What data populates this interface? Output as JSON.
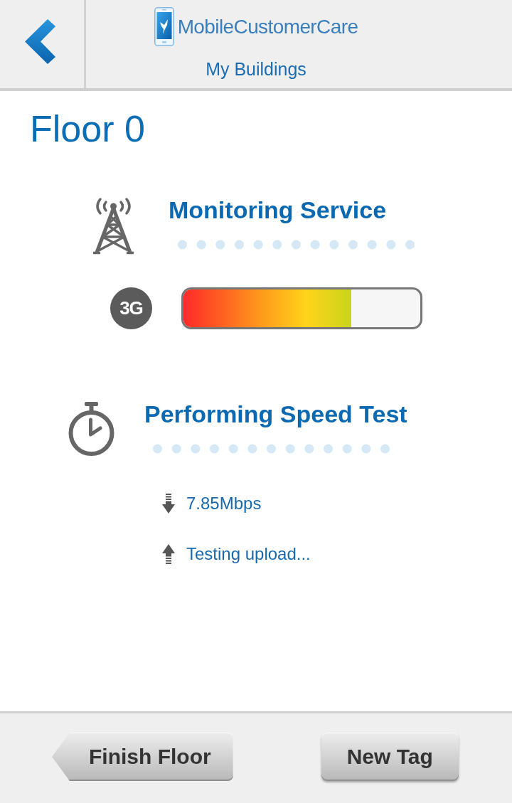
{
  "header": {
    "logo_text": "MobileCustomerCare",
    "title": "My Buildings"
  },
  "page_title": "Floor 0",
  "sections": [
    {
      "kind": "monitoring",
      "title": "Monitoring Service",
      "network_type": "3G",
      "level": 0.71
    },
    {
      "kind": "speed_test",
      "title": "Performing Speed Test",
      "results": [
        {
          "kind": "download",
          "text": "7.85Mbps"
        },
        {
          "kind": "upload",
          "text": "Testing upload..."
        }
      ]
    }
  ],
  "footer": {
    "buttons": [
      {
        "label": "Finish Floor",
        "kind": "back"
      },
      {
        "label": "New Tag",
        "kind": "plain"
      }
    ]
  }
}
